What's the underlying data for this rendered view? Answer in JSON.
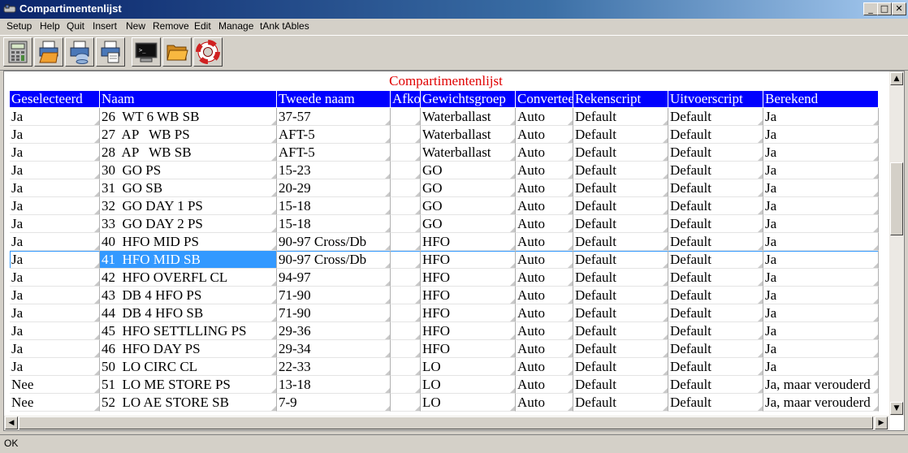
{
  "window": {
    "title": "Compartimentenlijst"
  },
  "menu": [
    "Setup",
    "Help",
    "Quit",
    "Insert",
    "New",
    "Remove",
    "Edit",
    "Manage",
    "tAnk tAbles"
  ],
  "toolbar": [
    {
      "icon": "calculator-icon"
    },
    {
      "icon": "print-folder-icon"
    },
    {
      "icon": "print-database-icon"
    },
    {
      "icon": "print-document-icon"
    },
    {
      "icon": "terminal-icon"
    },
    {
      "icon": "open-folder-icon"
    },
    {
      "icon": "lifebuoy-icon"
    }
  ],
  "grid": {
    "caption": "Compartimentenlijst",
    "columns": [
      "Geselecteerd",
      "Naam",
      "Tweede naam",
      "Afkort",
      "Gewichtsgroep",
      "Converteer",
      "Rekenscript",
      "Uitvoerscript",
      "Berekend"
    ],
    "selected_row": 8,
    "rows": [
      [
        "Ja",
        "26  WT 6 WB SB",
        "37-57",
        "",
        "Waterballast",
        "Auto",
        "Default",
        "Default",
        "Ja"
      ],
      [
        "Ja",
        "27  AP   WB PS",
        "AFT-5",
        "",
        "Waterballast",
        "Auto",
        "Default",
        "Default",
        "Ja"
      ],
      [
        "Ja",
        "28  AP   WB SB",
        "AFT-5",
        "",
        "Waterballast",
        "Auto",
        "Default",
        "Default",
        "Ja"
      ],
      [
        "Ja",
        "30  GO PS",
        "15-23",
        "",
        "GO",
        "Auto",
        "Default",
        "Default",
        "Ja"
      ],
      [
        "Ja",
        "31  GO SB",
        "20-29",
        "",
        "GO",
        "Auto",
        "Default",
        "Default",
        "Ja"
      ],
      [
        "Ja",
        "32  GO DAY 1 PS",
        "15-18",
        "",
        "GO",
        "Auto",
        "Default",
        "Default",
        "Ja"
      ],
      [
        "Ja",
        "33  GO DAY 2 PS",
        "15-18",
        "",
        "GO",
        "Auto",
        "Default",
        "Default",
        "Ja"
      ],
      [
        "Ja",
        "40  HFO MID PS",
        "90-97 Cross/Db",
        "",
        "HFO",
        "Auto",
        "Default",
        "Default",
        "Ja"
      ],
      [
        "Ja",
        "41  HFO MID SB",
        "90-97 Cross/Db",
        "",
        "HFO",
        "Auto",
        "Default",
        "Default",
        "Ja"
      ],
      [
        "Ja",
        "42  HFO OVERFL CL",
        "94-97",
        "",
        "HFO",
        "Auto",
        "Default",
        "Default",
        "Ja"
      ],
      [
        "Ja",
        "43  DB 4 HFO PS",
        "71-90",
        "",
        "HFO",
        "Auto",
        "Default",
        "Default",
        "Ja"
      ],
      [
        "Ja",
        "44  DB 4 HFO SB",
        "71-90",
        "",
        "HFO",
        "Auto",
        "Default",
        "Default",
        "Ja"
      ],
      [
        "Ja",
        "45  HFO SETTLLING PS",
        "29-36",
        "",
        "HFO",
        "Auto",
        "Default",
        "Default",
        "Ja"
      ],
      [
        "Ja",
        "46  HFO DAY PS",
        "29-34",
        "",
        "HFO",
        "Auto",
        "Default",
        "Default",
        "Ja"
      ],
      [
        "Ja",
        "50  LO CIRC CL",
        "22-33",
        "",
        "LO",
        "Auto",
        "Default",
        "Default",
        "Ja"
      ],
      [
        "Nee",
        "51  LO ME STORE PS",
        "13-18",
        "",
        "LO",
        "Auto",
        "Default",
        "Default",
        "Ja, maar verouderd"
      ],
      [
        "Nee",
        "52  LO AE STORE SB",
        "7-9",
        "",
        "LO",
        "Auto",
        "Default",
        "Default",
        "Ja, maar verouderd"
      ]
    ]
  },
  "status": {
    "text": "OK"
  }
}
